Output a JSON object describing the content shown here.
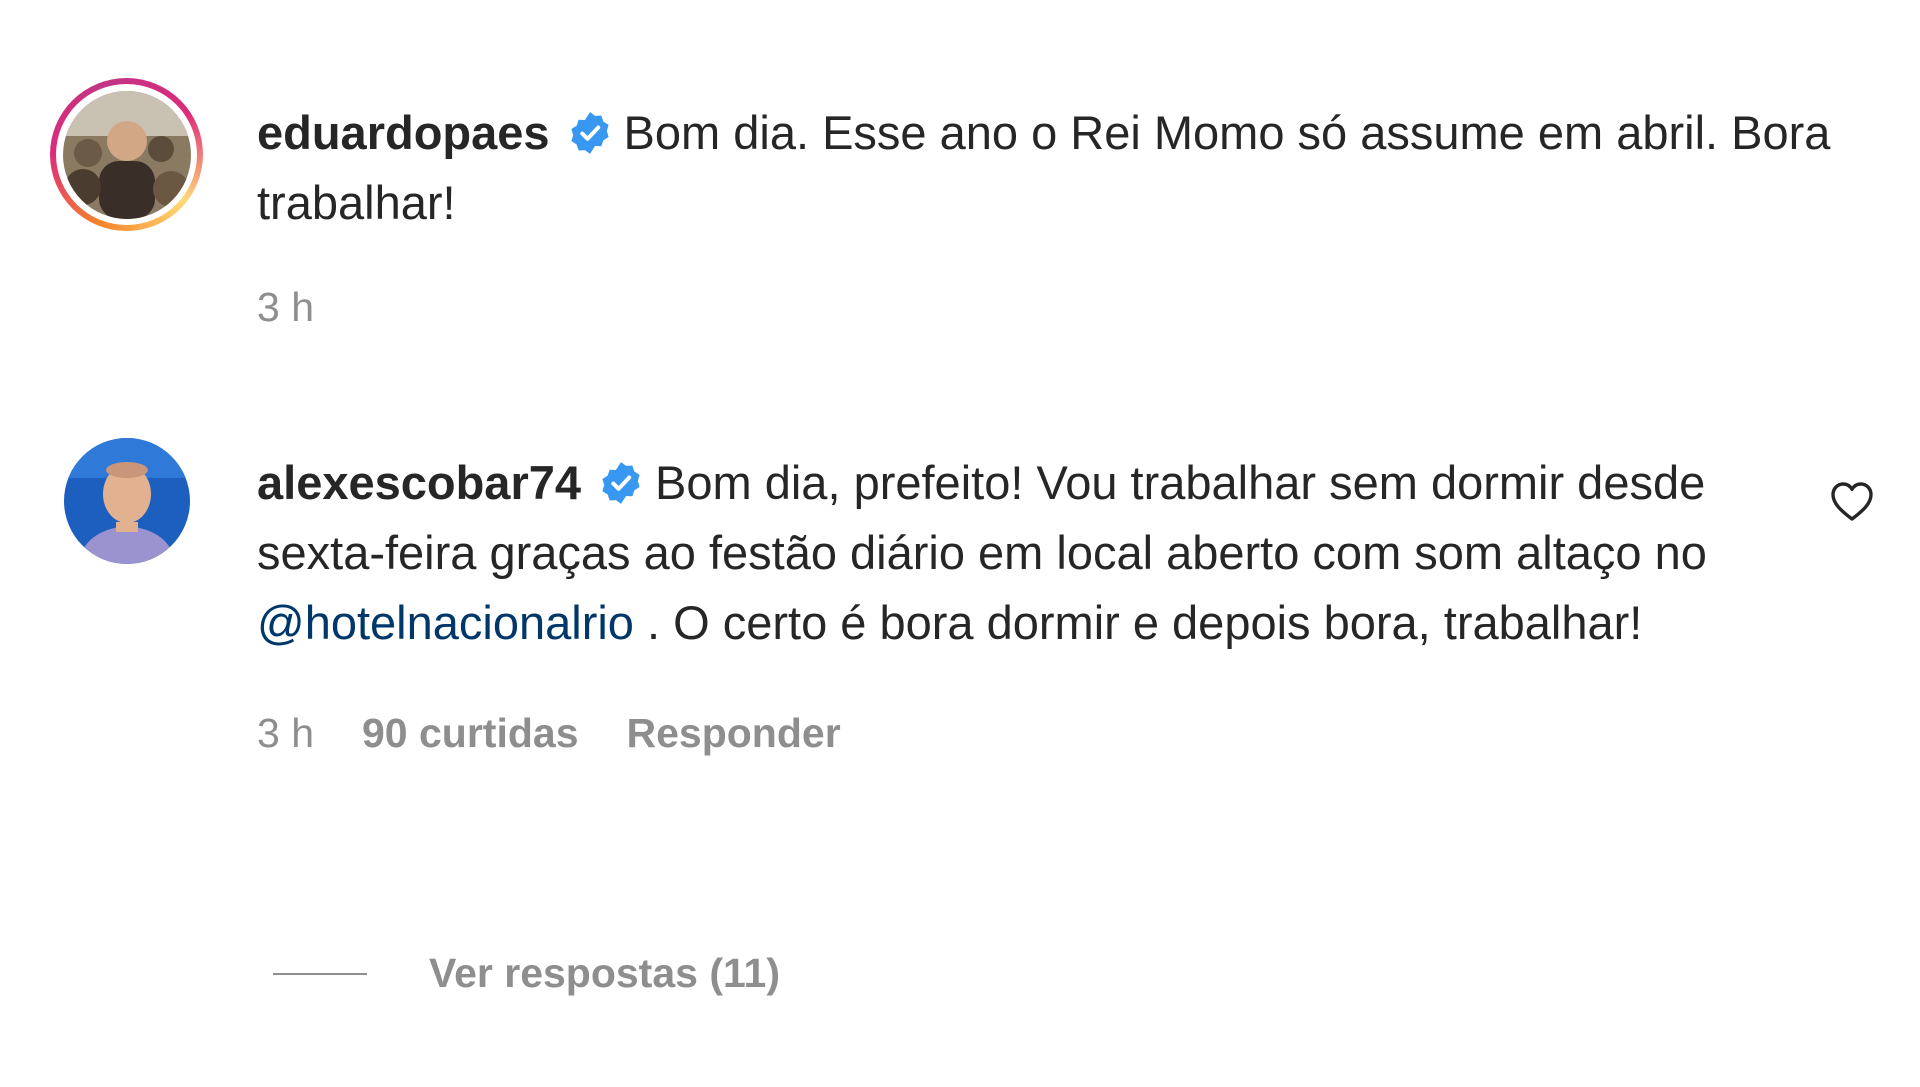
{
  "comments": [
    {
      "username": "eduardopaes",
      "verified_icon": "verified-badge-icon",
      "text_before_mention": "Bom dia. Esse ano o Rei Momo só assume em abril. Bora trabalhar!",
      "time": "3 h"
    },
    {
      "username": "alexescobar74",
      "verified_icon": "verified-badge-icon",
      "text_before_mention": "Bom dia, prefeito! Vou trabalhar sem dormir desde sexta-feira graças ao festão diário em local aberto com som altaço no ",
      "mention": "@hotelnacionalrio",
      "text_after_mention": " . O certo é bora dormir e depois bora, trabalhar!",
      "time": "3 h",
      "likes": "90 curtidas",
      "reply_label": "Responder",
      "like_icon": "heart-outline-icon"
    }
  ],
  "view_replies": {
    "label": "Ver respostas (11)"
  },
  "colors": {
    "text": "#262626",
    "muted": "#8e8e8e",
    "mention": "#00376b",
    "verified": "#3897f0"
  }
}
